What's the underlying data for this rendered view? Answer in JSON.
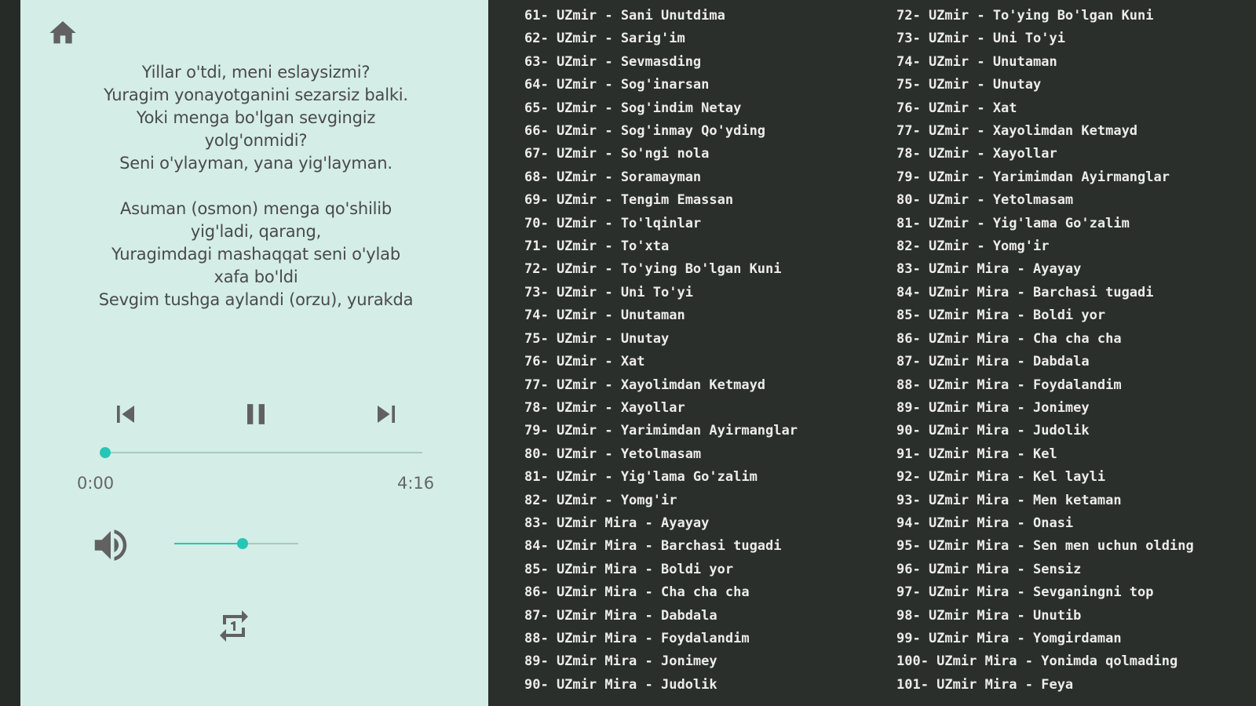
{
  "player": {
    "lyrics": "Yillar o'tdi, meni eslaysizmi?\nYuragim yonayotganini sezarsiz balki.\nYoki menga bo'lgan sevgingiz\nyolg'onmidi?\nSeni o'ylayman, yana yig'layman.\n\nAsuman (osmon) menga qo'shilib\nyig'ladi, qarang,\nYuragimdagi mashaqqat seni o'ylab\nxafa bo'ldi\nSevgim tushga aylandi (orzu), yurakda",
    "current_time": "0:00",
    "total_time": "4:16",
    "progress_fraction": 0.0,
    "volume_fraction": 0.55,
    "accent_color": "#26c6b7"
  },
  "playlist_col1": [
    "61- UZmir - Sani Unutdima",
    "62- UZmir - Sarig'im",
    "63- UZmir - Sevmasding",
    "64- UZmir - Sog'inarsan",
    "65- UZmir - Sog'indim Netay",
    "66- UZmir - Sog'inmay Qo'yding",
    "67- UZmir - So'ngi nola",
    "68- UZmir - Soramayman",
    "69- UZmir - Tengim Emassan",
    "70- UZmir - To'lqinlar",
    "71- UZmir - To'xta",
    "72- UZmir - To'ying Bo'lgan Kuni",
    "73- UZmir - Uni To'yi",
    "74- UZmir - Unutaman",
    "75- UZmir - Unutay",
    "76- UZmir - Xat",
    "77- UZmir - Xayolimdan Ketmayd",
    "78- UZmir - Xayollar",
    "79- UZmir - Yarimimdan Ayirmanglar",
    "80- UZmir - Yetolmasam",
    "81- UZmir - Yig'lama Go'zalim",
    "82- UZmir - Yomg'ir",
    "83- UZmir Mira - Ayayay",
    "84- UZmir Mira - Barchasi tugadi",
    "85- UZmir Mira - Boldi yor",
    "86- UZmir Mira - Cha cha cha",
    "87- UZmir Mira - Dabdala",
    "88- UZmir Mira - Foydalandim",
    "89- UZmir Mira - Jonimey",
    "90- UZmir Mira - Judolik"
  ],
  "playlist_col2": [
    "72- UZmir - To'ying Bo'lgan Kuni",
    "73- UZmir - Uni To'yi",
    "74- UZmir - Unutaman",
    "75- UZmir - Unutay",
    "76- UZmir - Xat",
    "77- UZmir - Xayolimdan Ketmayd",
    "78- UZmir - Xayollar",
    "79- UZmir - Yarimimdan Ayirmanglar",
    "80- UZmir - Yetolmasam",
    "81- UZmir - Yig'lama Go'zalim",
    "82- UZmir - Yomg'ir",
    "83- UZmir Mira - Ayayay",
    "84- UZmir Mira - Barchasi tugadi",
    "85- UZmir Mira - Boldi yor",
    "86- UZmir Mira - Cha cha cha",
    "87- UZmir Mira - Dabdala",
    "88- UZmir Mira - Foydalandim",
    "89- UZmir Mira - Jonimey",
    "90- UZmir Mira - Judolik",
    "91- UZmir Mira - Kel",
    "92- UZmir Mira - Kel layli",
    "93- UZmir Mira - Men ketaman",
    "94- UZmir Mira - Onasi",
    "95- UZmir Mira - Sen men uchun olding",
    "96- UZmir Mira - Sensiz",
    "97- UZmir Mira - Sevganingni top",
    "98- UZmir Mira - Unutib",
    "99- UZmir Mira - Yomgirdaman",
    "100- UZmir Mira - Yonimda qolmading",
    "101- UZmir Mira - Feya"
  ],
  "icons": {
    "home": "home-icon",
    "previous": "skip-previous-icon",
    "pause": "pause-icon",
    "next": "skip-next-icon",
    "volume": "volume-icon",
    "repeat": "repeat-one-icon"
  }
}
